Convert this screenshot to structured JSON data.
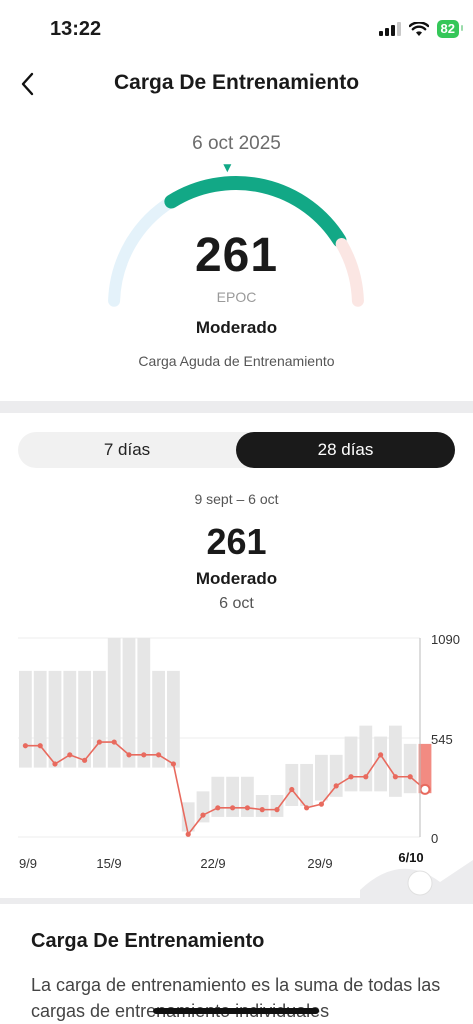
{
  "status_bar": {
    "time": "13:22",
    "battery": "82"
  },
  "header": {
    "title": "Carga De Entrenamiento"
  },
  "summary": {
    "date": "6 oct 2025",
    "value": "261",
    "unit": "EPOC",
    "level": "Moderado",
    "label": "Carga Aguda de Entrenamiento",
    "gauge_fraction": 0.48
  },
  "period_toggle": {
    "options": [
      "7 días",
      "28 días"
    ],
    "selected": "28 días"
  },
  "detail": {
    "range": "9 sept – 6 oct",
    "value": "261",
    "level": "Moderado",
    "date": "6 oct"
  },
  "chart_data": {
    "type": "line",
    "x": [
      "9/9",
      "10/9",
      "11/9",
      "12/9",
      "13/9",
      "14/9",
      "15/9",
      "16/9",
      "17/9",
      "18/9",
      "19/9",
      "20/9",
      "21/9",
      "22/9",
      "23/9",
      "24/9",
      "25/9",
      "26/9",
      "27/9",
      "28/9",
      "29/9",
      "30/9",
      "1/10",
      "2/10",
      "3/10",
      "4/10",
      "5/10",
      "6/10"
    ],
    "x_tick_labels": [
      "9/9",
      "15/9",
      "22/9",
      "29/9",
      "6/10"
    ],
    "y_tick_labels": [
      "1090",
      "545",
      "0"
    ],
    "ylim": [
      0,
      1090
    ],
    "series": [
      {
        "values": [
          500,
          500,
          400,
          450,
          420,
          520,
          520,
          450,
          450,
          450,
          400,
          15,
          120,
          160,
          160,
          160,
          150,
          150,
          260,
          160,
          180,
          280,
          330,
          330,
          450,
          330,
          330,
          261
        ]
      }
    ],
    "optimal_range": [
      [
        380,
        910
      ],
      [
        380,
        910
      ],
      [
        380,
        910
      ],
      [
        380,
        910
      ],
      [
        380,
        910
      ],
      [
        380,
        910
      ],
      [
        380,
        1090
      ],
      [
        380,
        1090
      ],
      [
        380,
        1090
      ],
      [
        380,
        910
      ],
      [
        380,
        910
      ],
      [
        30,
        190
      ],
      [
        80,
        250
      ],
      [
        110,
        330
      ],
      [
        110,
        330
      ],
      [
        110,
        330
      ],
      [
        110,
        230
      ],
      [
        110,
        230
      ],
      [
        170,
        400
      ],
      [
        170,
        400
      ],
      [
        200,
        450
      ],
      [
        220,
        450
      ],
      [
        250,
        550
      ],
      [
        250,
        610
      ],
      [
        250,
        550
      ],
      [
        220,
        610
      ],
      [
        240,
        510
      ],
      [
        240,
        510
      ]
    ],
    "highlight_color": "#f28b82",
    "line_color": "#e86a5e"
  },
  "info": {
    "title": "Carga De Entrenamiento",
    "text": "La carga de entrenamiento es la suma de todas las cargas de entrenamiento individuales"
  }
}
